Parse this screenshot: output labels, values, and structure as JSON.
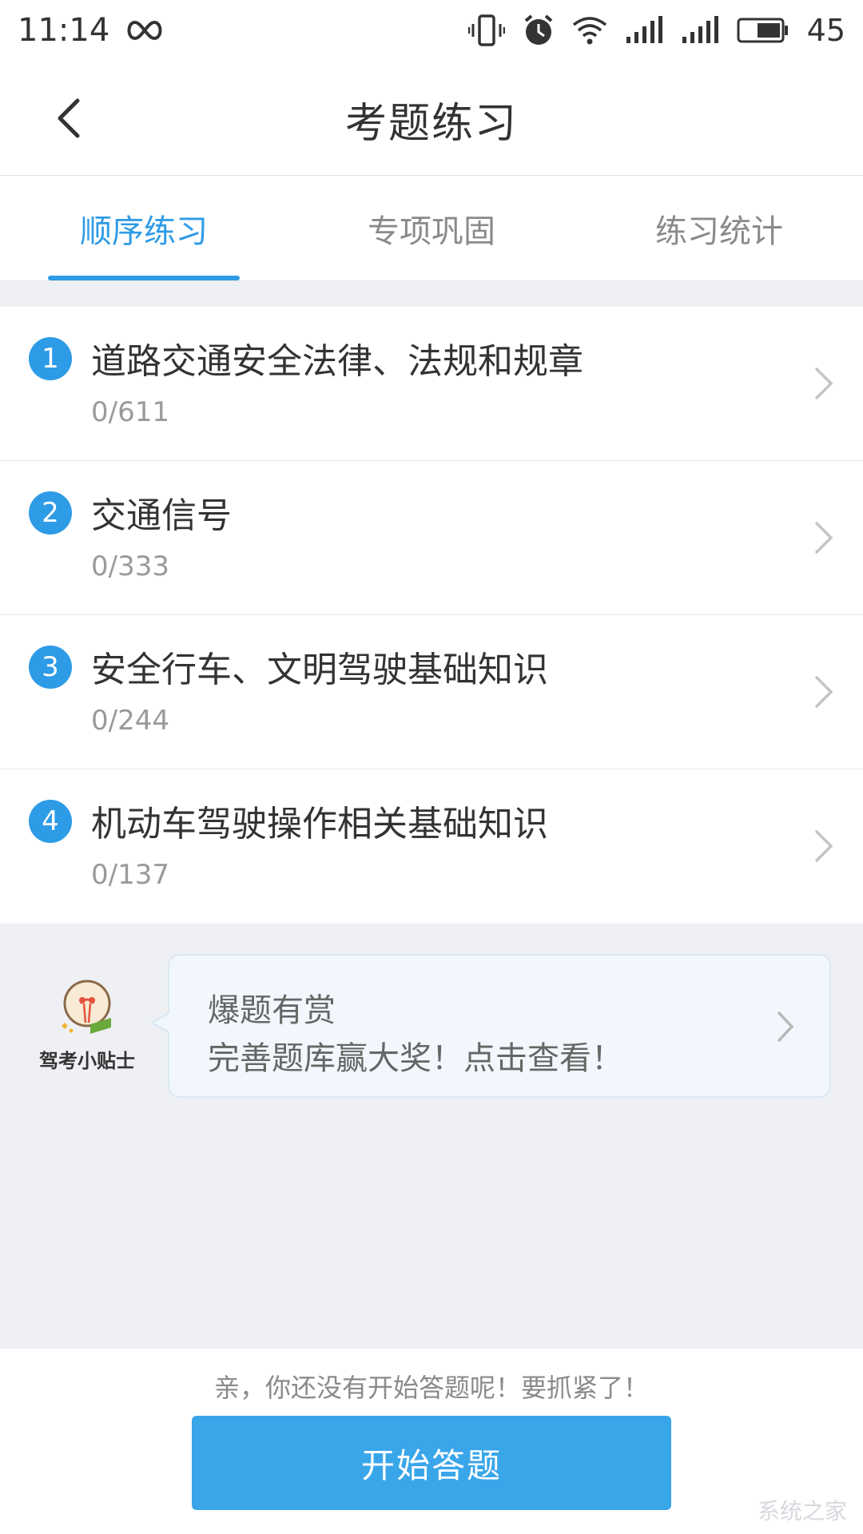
{
  "status_bar": {
    "time": "11:14",
    "battery": "45",
    "icons": [
      "infinity-icon",
      "vibrate-icon",
      "alarm-icon",
      "wifi-icon",
      "signal-icon",
      "signal-icon",
      "battery-icon"
    ]
  },
  "header": {
    "title": "考题练习",
    "back_icon": "chevron-left-icon"
  },
  "tabs": [
    {
      "label": "顺序练习",
      "active": true
    },
    {
      "label": "专项巩固",
      "active": false
    },
    {
      "label": "练习统计",
      "active": false
    }
  ],
  "chapters": [
    {
      "index": "1",
      "title": "道路交通安全法律、法规和规章",
      "progress": "0/611"
    },
    {
      "index": "2",
      "title": "交通信号",
      "progress": "0/333"
    },
    {
      "index": "3",
      "title": "安全行车、文明驾驶基础知识",
      "progress": "0/244"
    },
    {
      "index": "4",
      "title": "机动车驾驶操作相关基础知识",
      "progress": "0/137"
    }
  ],
  "tip": {
    "mascot_label": "驾考小贴士",
    "line1": "爆题有赏",
    "line2": "完善题库赢大奖！点击查看！"
  },
  "bottom": {
    "hint": "亲，你还没有开始答题呢！要抓紧了！",
    "start_button": "开始答题"
  },
  "watermark": "系统之家",
  "colors": {
    "accent": "#2e9be6",
    "button": "#3aa6ea",
    "background": "#eef0f4"
  }
}
